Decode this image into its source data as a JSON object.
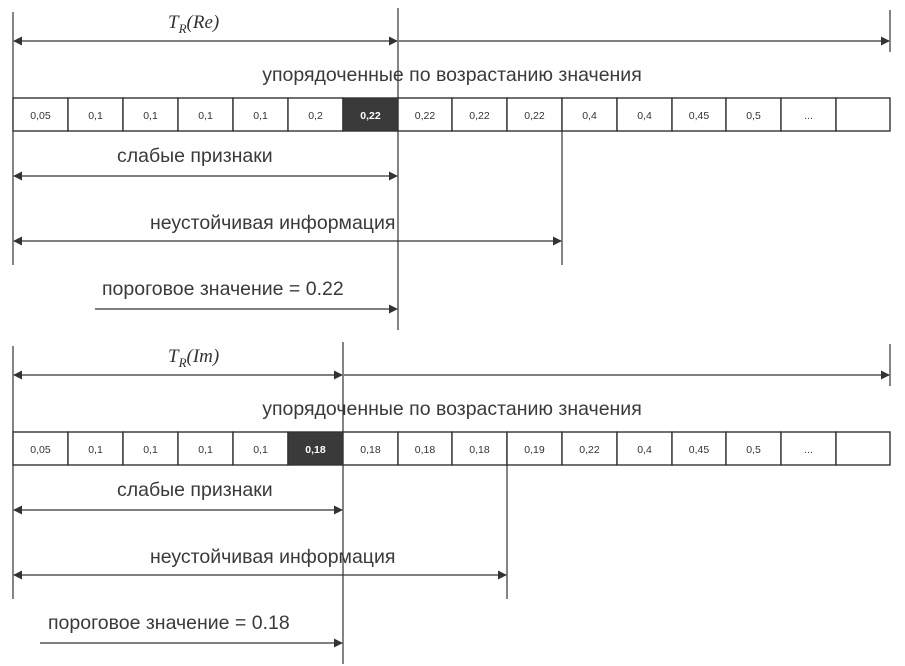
{
  "panels": [
    {
      "id": "re",
      "threshold_symbol": "T",
      "threshold_subscript": "R",
      "threshold_argument": "(Re)",
      "ordered_label": "упорядоченные по возрастанию значения",
      "cells": [
        "0,05",
        "0,1",
        "0,1",
        "0,1",
        "0,1",
        "0,2",
        "0,22",
        "0,22",
        "0,22",
        "0,22",
        "0,4",
        "0,4",
        "0,45",
        "0,5",
        "...",
        ""
      ],
      "highlight_index": 6,
      "weak_label": "слабые признаки",
      "unstable_label": "неустойчивая информация",
      "threshold_label": "пороговое значение = 0.22",
      "highlight_color": "#3a3a3a"
    },
    {
      "id": "im",
      "threshold_symbol": "T",
      "threshold_subscript": "R",
      "threshold_argument": "(Im)",
      "ordered_label": "упорядоченные по возрастанию значения",
      "cells": [
        "0,05",
        "0,1",
        "0,1",
        "0,1",
        "0,1",
        "0,18",
        "0,18",
        "0,18",
        "0,18",
        "0,19",
        "0,22",
        "0,4",
        "0,45",
        "0,5",
        "...",
        ""
      ],
      "highlight_index": 5,
      "weak_label": "слабые признаки",
      "unstable_label": "неустойчивая информация",
      "threshold_label": "пороговое значение = 0.18",
      "highlight_color": "#3a3a3a"
    }
  ]
}
